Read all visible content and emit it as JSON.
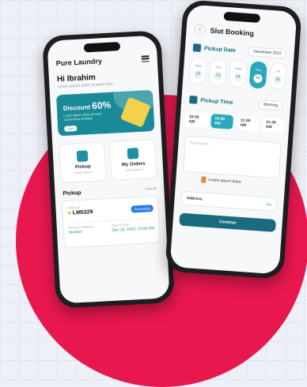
{
  "colors": {
    "accent": "#e8184f",
    "teal": "#1a8a99",
    "dark_teal": "#1a6b80",
    "active": "#2aa8bd"
  },
  "left_phone": {
    "app_title": "Pure Laundry",
    "greeting": "Hi Ibrahim",
    "greeting_sub": "Lorem ipsum dolor sit amet sed...",
    "banner": {
      "title": "Discount",
      "percent": "60%",
      "sub": "Lorem ipsum dolor sit amet consectetur booking",
      "button": "Get"
    },
    "tiles": [
      {
        "icon": "pickup-icon",
        "label": "Pickup",
        "sub": "Lorem ipsum"
      },
      {
        "icon": "orders-icon",
        "label": "My Orders",
        "sub": "Lorem ipsum"
      }
    ],
    "pickup_section": {
      "title": "Pickup",
      "link": "View All"
    },
    "order": {
      "id_label": "Order ID",
      "id": "LM5329",
      "status": "Processing",
      "delivery_label": "Pickup & Delivery",
      "delivery_value": "Ibrahim",
      "date_label": "Date & Time",
      "date_value": "Dec 19, 2022, 12:00 AM"
    }
  },
  "right_phone": {
    "title": "Slot Booking",
    "pickup_date": {
      "label": "Pickup Date",
      "value": "December 2022"
    },
    "days": [
      {
        "name": "Mon",
        "date": "12"
      },
      {
        "name": "Tue",
        "date": "13"
      },
      {
        "name": "Wed",
        "date": "14"
      },
      {
        "name": "Thu",
        "date": "15"
      },
      {
        "name": "Fri",
        "date": "16"
      }
    ],
    "pickup_time": {
      "label": "Pickup Time",
      "value": "Morning"
    },
    "times": [
      "10:00 AM",
      "10:30 AM",
      "11:00 AM",
      "11:30 AM"
    ],
    "comments_placeholder": "Comments",
    "lorem_line": "Lorem ipsum dolor",
    "address": {
      "label": "Address",
      "action": "Edit"
    },
    "continue_label": "Continue"
  }
}
